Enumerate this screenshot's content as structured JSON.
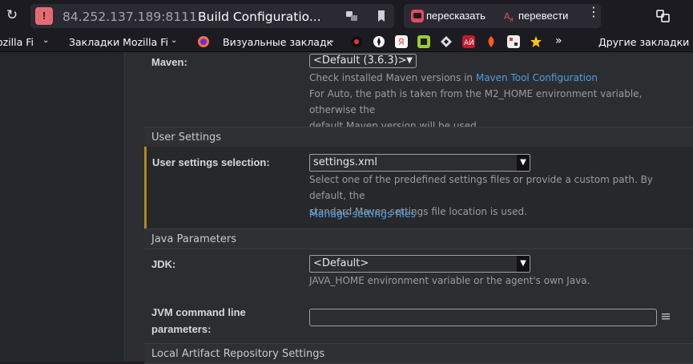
{
  "browser": {
    "url": "84.252.137.189:8111",
    "tab_title": "Build Configuratio...",
    "ext_retell": "пересказать",
    "ext_translate": "перевести",
    "warning_glyph": "!",
    "kebab": "⋮"
  },
  "bookmarks": {
    "items": [
      "ozilla Fi",
      "Закладки Mozilla Fi",
      "Визуальные закладк",
      "Другие закладки"
    ],
    "overflow": "»"
  },
  "form": {
    "maven": {
      "label": "Maven:",
      "value": "<Default (3.6.3)>",
      "help_prefix": "Check installed Maven versions in ",
      "help_link": "Maven Tool Configuration",
      "help_line2": "For Auto, the path is taken from the M2_HOME environment variable, otherwise the",
      "help_line3": "default Maven version will be used."
    },
    "user_settings": {
      "section": "User Settings",
      "label": "User settings selection:",
      "value": "settings.xml",
      "help_line1": "Select one of the predefined settings files or provide a custom path. By default, the",
      "help_line2": "standard Maven settings file location is used.",
      "link": "Manage settings files"
    },
    "java": {
      "section": "Java Parameters",
      "jdk_label": "JDK:",
      "jdk_value": "<Default>",
      "jdk_help": "JAVA_HOME environment variable or the agent's own Java.",
      "jvm_label_line1": "JVM command line",
      "jvm_label_line2": "parameters:",
      "jvm_value": ""
    },
    "local_repo": {
      "section": "Local Artifact Repository Settings"
    }
  },
  "colors": {
    "accent_link": "#4f9fe6",
    "highlight_bar": "#b08a1a",
    "warning": "#e56b73"
  }
}
